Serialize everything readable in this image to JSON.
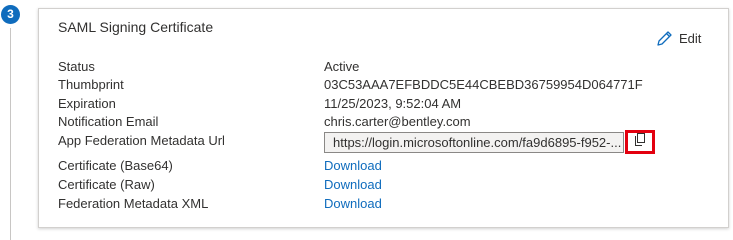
{
  "step": {
    "number": "3"
  },
  "card": {
    "title": "SAML Signing Certificate",
    "edit_label": "Edit",
    "fields": [
      {
        "label": "Status",
        "value": "Active"
      },
      {
        "label": "Thumbprint",
        "value": "03C53AAA7EFBDDC5E44CBEBD36759954D064771F"
      },
      {
        "label": "Expiration",
        "value": "11/25/2023, 9:52:04 AM"
      },
      {
        "label": "Notification Email",
        "value": "chris.carter@bentley.com"
      },
      {
        "label": "App Federation Metadata Url",
        "value": "https://login.microsoftonline.com/fa9d6895-f952-..."
      },
      {
        "label": "Certificate (Base64)",
        "value": "Download"
      },
      {
        "label": "Certificate (Raw)",
        "value": "Download"
      },
      {
        "label": "Federation Metadata XML",
        "value": "Download"
      }
    ]
  },
  "icons": {
    "edit": "pencil-icon",
    "copy": "copy-icon"
  },
  "colors": {
    "accent": "#0f6cbd",
    "highlight": "#e3000f"
  }
}
